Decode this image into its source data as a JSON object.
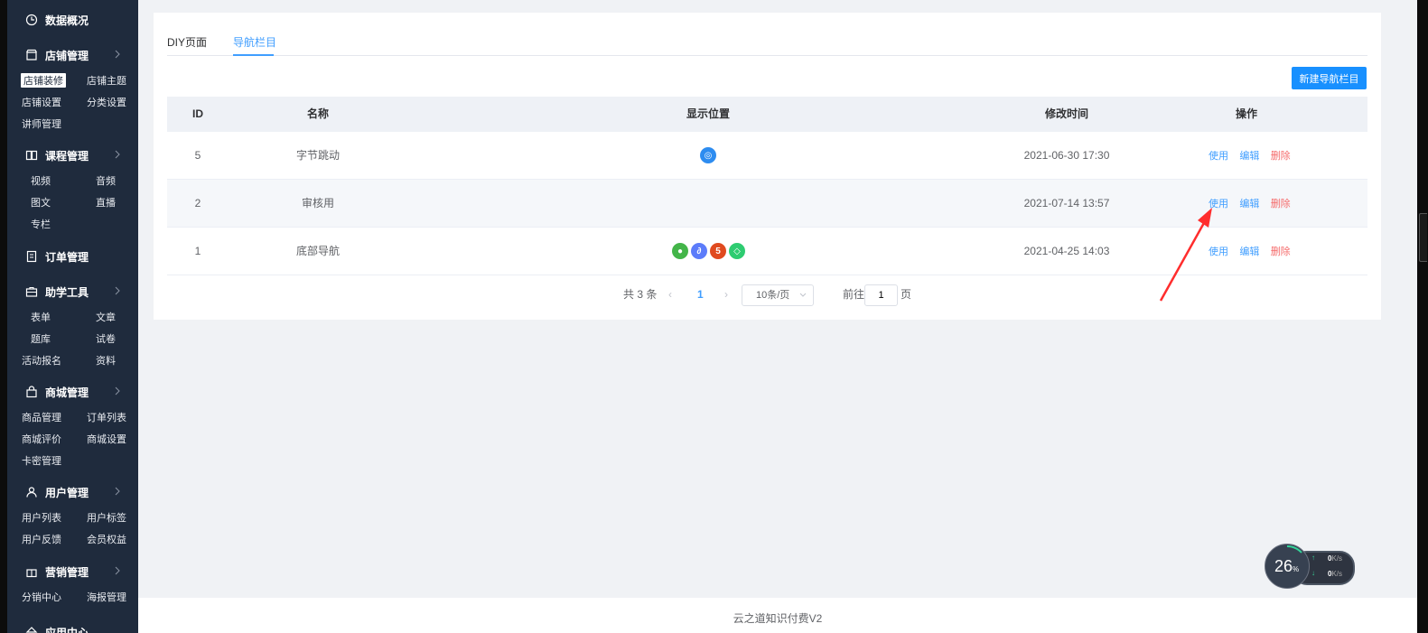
{
  "sidebar": {
    "groups": [
      {
        "label": "数据概况",
        "icon": "clock-icon"
      },
      {
        "label": "店铺管理",
        "icon": "store-icon"
      },
      {
        "label": "课程管理",
        "icon": "book-icon"
      },
      {
        "label": "订单管理",
        "icon": "order-icon"
      },
      {
        "label": "助学工具",
        "icon": "briefcase-icon"
      },
      {
        "label": "商城管理",
        "icon": "bag-icon"
      },
      {
        "label": "用户管理",
        "icon": "user-icon"
      },
      {
        "label": "营销管理",
        "icon": "gift-icon"
      }
    ],
    "store_items": [
      "店铺装修",
      "店铺主题",
      "店铺设置",
      "分类设置",
      "讲师管理"
    ],
    "course_items": [
      "视频",
      "音频",
      "图文",
      "直播",
      "专栏"
    ],
    "tool_items": [
      "表单",
      "文章",
      "题库",
      "试卷",
      "活动报名",
      "资料"
    ],
    "mall_items": [
      "商品管理",
      "订单列表",
      "商城评价",
      "商城设置",
      "卡密管理"
    ],
    "user_items": [
      "用户列表",
      "用户标签",
      "用户反馈",
      "会员权益"
    ],
    "marketing_items": [
      "分销中心",
      "海报管理"
    ],
    "cutoff_label": "应用中心"
  },
  "tabs": {
    "diy": "DIY页面",
    "nav": "导航栏目"
  },
  "new_button": "新建导航栏目",
  "table": {
    "headers": {
      "id": "ID",
      "name": "名称",
      "position": "显示位置",
      "mtime": "修改时间",
      "ops": "操作"
    },
    "rows": [
      {
        "id": "5",
        "name": "字节跳动",
        "mtime": "2021-06-30 17:30"
      },
      {
        "id": "2",
        "name": "审核用",
        "mtime": "2021-07-14 13:57"
      },
      {
        "id": "1",
        "name": "底部导航",
        "mtime": "2021-04-25 14:03"
      }
    ],
    "op_use": "使用",
    "op_edit": "编辑",
    "op_delete": "删除"
  },
  "pagination": {
    "total": "共 3 条",
    "current": "1",
    "page_size": "10条/页",
    "goto_label": "前往",
    "goto_value": "1",
    "page_unit": "页"
  },
  "footer": "云之道知识付费V2",
  "net_widget": {
    "percent": "26",
    "percent_unit": "%",
    "up": "0",
    "down": "0",
    "rate_unit": "K/s"
  },
  "colors": {
    "sidebar": "#1f2b3d",
    "primary": "#1890ff",
    "link": "#409eff",
    "danger": "#f56c6c",
    "arrow": "#ff2d2d"
  }
}
